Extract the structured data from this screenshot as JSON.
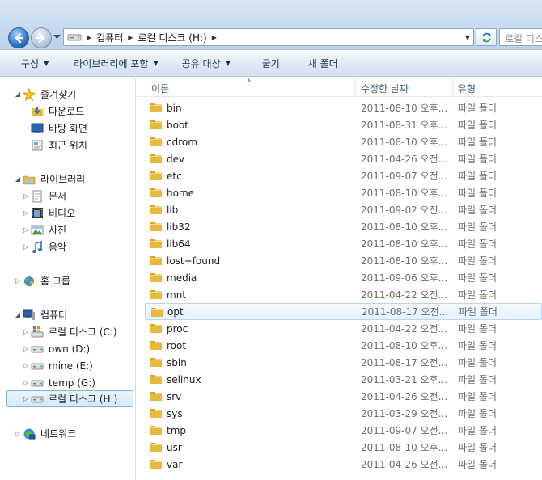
{
  "address": {
    "breadcrumbs": [
      "컴퓨터",
      "로컬 디스크 (H:)"
    ],
    "search_placeholder": "로컬 디스"
  },
  "toolbar": {
    "organize": "구성",
    "include_library": "라이브러리에 포함",
    "share_with": "공유 대상",
    "burn": "굽기",
    "new_folder": "새 폴더"
  },
  "nav": {
    "favorites": "즐겨찾기",
    "downloads": "다운로드",
    "desktop": "바탕 화면",
    "recent": "최근 위치",
    "libraries": "라이브러리",
    "documents": "문서",
    "videos": "비디오",
    "pictures": "사진",
    "music": "음악",
    "homegroup": "홈 그룹",
    "computer": "컴퓨터",
    "drive_c": "로컬 디스크 (C:)",
    "drive_d": "own (D:)",
    "drive_e": "mine (E:)",
    "drive_g": "temp (G:)",
    "drive_h": "로컬 디스크 (H:)",
    "network": "네트워크"
  },
  "columns": {
    "name": "이름",
    "date": "수정한 날짜",
    "type": "유형"
  },
  "files": [
    {
      "name": "bin",
      "date": "2011-08-10 오후...",
      "type": "파일 폴더"
    },
    {
      "name": "boot",
      "date": "2011-08-31 오후...",
      "type": "파일 폴더"
    },
    {
      "name": "cdrom",
      "date": "2011-08-10 오후...",
      "type": "파일 폴더"
    },
    {
      "name": "dev",
      "date": "2011-04-26 오전...",
      "type": "파일 폴더"
    },
    {
      "name": "etc",
      "date": "2011-09-07 오전...",
      "type": "파일 폴더"
    },
    {
      "name": "home",
      "date": "2011-08-10 오후...",
      "type": "파일 폴더"
    },
    {
      "name": "lib",
      "date": "2011-09-02 오전...",
      "type": "파일 폴더"
    },
    {
      "name": "lib32",
      "date": "2011-08-10 오후...",
      "type": "파일 폴더"
    },
    {
      "name": "lib64",
      "date": "2011-08-10 오후...",
      "type": "파일 폴더"
    },
    {
      "name": "lost+found",
      "date": "2011-08-10 오후...",
      "type": "파일 폴더"
    },
    {
      "name": "media",
      "date": "2011-09-06 오후...",
      "type": "파일 폴더"
    },
    {
      "name": "mnt",
      "date": "2011-04-22 오전...",
      "type": "파일 폴더"
    },
    {
      "name": "opt",
      "date": "2011-08-17 오전...",
      "type": "파일 폴더"
    },
    {
      "name": "proc",
      "date": "2011-04-22 오전...",
      "type": "파일 폴더"
    },
    {
      "name": "root",
      "date": "2011-08-10 오후...",
      "type": "파일 폴더"
    },
    {
      "name": "sbin",
      "date": "2011-08-17 오전...",
      "type": "파일 폴더"
    },
    {
      "name": "selinux",
      "date": "2011-03-21 오후...",
      "type": "파일 폴더"
    },
    {
      "name": "srv",
      "date": "2011-04-26 오전...",
      "type": "파일 폴더"
    },
    {
      "name": "sys",
      "date": "2011-03-29 오전...",
      "type": "파일 폴더"
    },
    {
      "name": "tmp",
      "date": "2011-09-07 오전...",
      "type": "파일 폴더"
    },
    {
      "name": "usr",
      "date": "2011-08-10 오후...",
      "type": "파일 폴더"
    },
    {
      "name": "var",
      "date": "2011-04-26 오전...",
      "type": "파일 폴더"
    }
  ],
  "hovered_file": "opt",
  "colors": {
    "folder": "#e8b93a",
    "selection_border": "#7eb4ea",
    "toolbar_text": "#1e3150"
  }
}
